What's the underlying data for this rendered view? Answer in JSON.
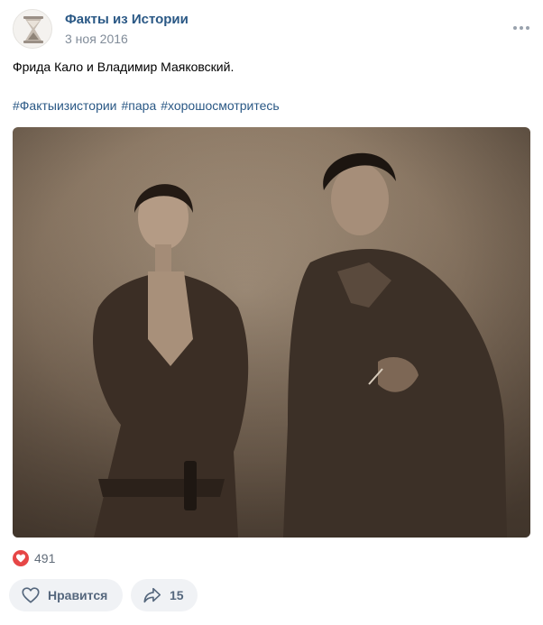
{
  "post": {
    "author": "Факты из Истории",
    "date": "3 ноя 2016",
    "text": "Фрида Кало и Владимир Маяковский.",
    "hashtags": [
      "#Фактыизистории",
      "#пара",
      "#хорошосмотритесь"
    ]
  },
  "reactions": {
    "likes_count": "491",
    "like_button_label": "Нравится",
    "share_count": "15"
  },
  "icons": {
    "avatar": "hourglass-icon",
    "more": "more-dots-icon",
    "like_badge": "heart-icon",
    "like_button": "heart-outline-icon",
    "share_button": "share-arrow-icon"
  },
  "colors": {
    "link": "#2a5885",
    "secondary": "#818c99",
    "like_red": "#e64646",
    "button_bg": "#f0f2f5"
  }
}
